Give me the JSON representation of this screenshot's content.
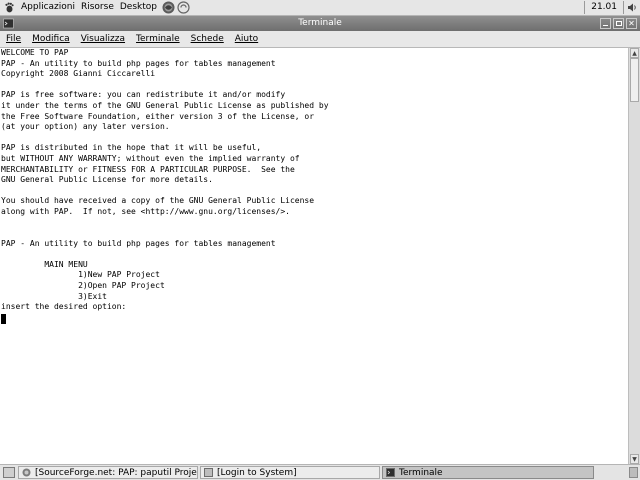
{
  "top_panel": {
    "menus": [
      "Applicazioni",
      "Risorse",
      "Desktop"
    ],
    "clock": "21.01"
  },
  "window": {
    "title": "Terminale"
  },
  "menubar": {
    "items": [
      "File",
      "Modifica",
      "Visualizza",
      "Terminale",
      "Schede",
      "Aiuto"
    ]
  },
  "terminal": {
    "lines": [
      "WELCOME TO PAP",
      "PAP - An utility to build php pages for tables management",
      "Copyright 2008 Gianni Ciccarelli",
      "",
      "PAP is free software: you can redistribute it and/or modify",
      "it under the terms of the GNU General Public License as published by",
      "the Free Software Foundation, either version 3 of the License, or",
      "(at your option) any later version.",
      "",
      "PAP is distributed in the hope that it will be useful,",
      "but WITHOUT ANY WARRANTY; without even the implied warranty of",
      "MERCHANTABILITY or FITNESS FOR A PARTICULAR PURPOSE.  See the",
      "GNU General Public License for more details.",
      "",
      "You should have received a copy of the GNU General Public License",
      "along with PAP.  If not, see <http://www.gnu.org/licenses/>.",
      "",
      "",
      "PAP - An utility to build php pages for tables management",
      "",
      "         MAIN MENU",
      "                1)New PAP Project",
      "                2)Open PAP Project",
      "                3)Exit",
      "insert the desired option:"
    ]
  },
  "taskbar": {
    "tasks": [
      {
        "label": "[SourceForge.net: PAP: paputil Project:...",
        "active": false
      },
      {
        "label": "[Login to System]",
        "active": false
      },
      {
        "label": "Terminale",
        "active": true
      }
    ]
  },
  "icons": {
    "foot": "gnome-foot-icon",
    "browser": "browser-launcher-icon",
    "mail": "mail-launcher-icon",
    "terminal": "terminal-icon"
  }
}
